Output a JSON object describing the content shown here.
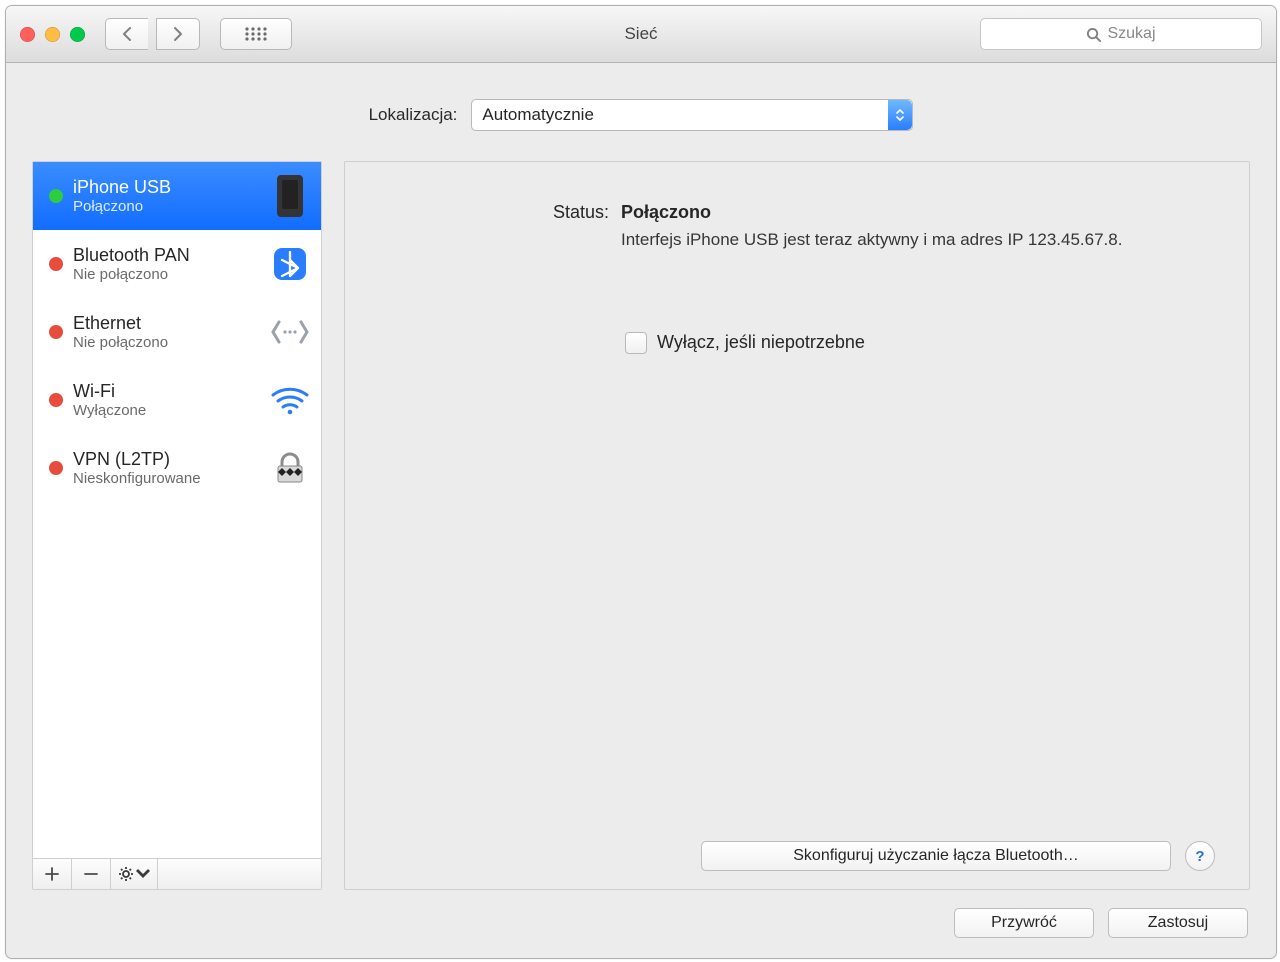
{
  "window": {
    "title": "Sieć",
    "search_placeholder": "Szukaj"
  },
  "location": {
    "label": "Lokalizacja:",
    "value": "Automatycznie"
  },
  "services": [
    {
      "name": "iPhone USB",
      "status": "Połączono",
      "dot": "green",
      "selected": true,
      "icon": "iphone-icon"
    },
    {
      "name": "Bluetooth PAN",
      "status": "Nie połączono",
      "dot": "red",
      "selected": false,
      "icon": "bluetooth-icon"
    },
    {
      "name": "Ethernet",
      "status": "Nie połączono",
      "dot": "red",
      "selected": false,
      "icon": "ethernet-icon"
    },
    {
      "name": "Wi-Fi",
      "status": "Wyłączone",
      "dot": "red",
      "selected": false,
      "icon": "wifi-icon"
    },
    {
      "name": "VPN (L2TP)",
      "status": "Nieskonfigurowane",
      "dot": "red",
      "selected": false,
      "icon": "vpn-icon"
    }
  ],
  "detail": {
    "status_label": "Status:",
    "status_value": "Połączono",
    "status_desc": "Interfejs iPhone USB  jest teraz aktywny i ma adres IP 123.45.67.8.",
    "disable_checkbox_label": "Wyłącz, jeśli niepotrzebne",
    "configure_button": "Skonfiguruj użyczanie łącza Bluetooth…"
  },
  "buttons": {
    "help": "?",
    "revert": "Przywróć",
    "apply": "Zastosuj"
  }
}
